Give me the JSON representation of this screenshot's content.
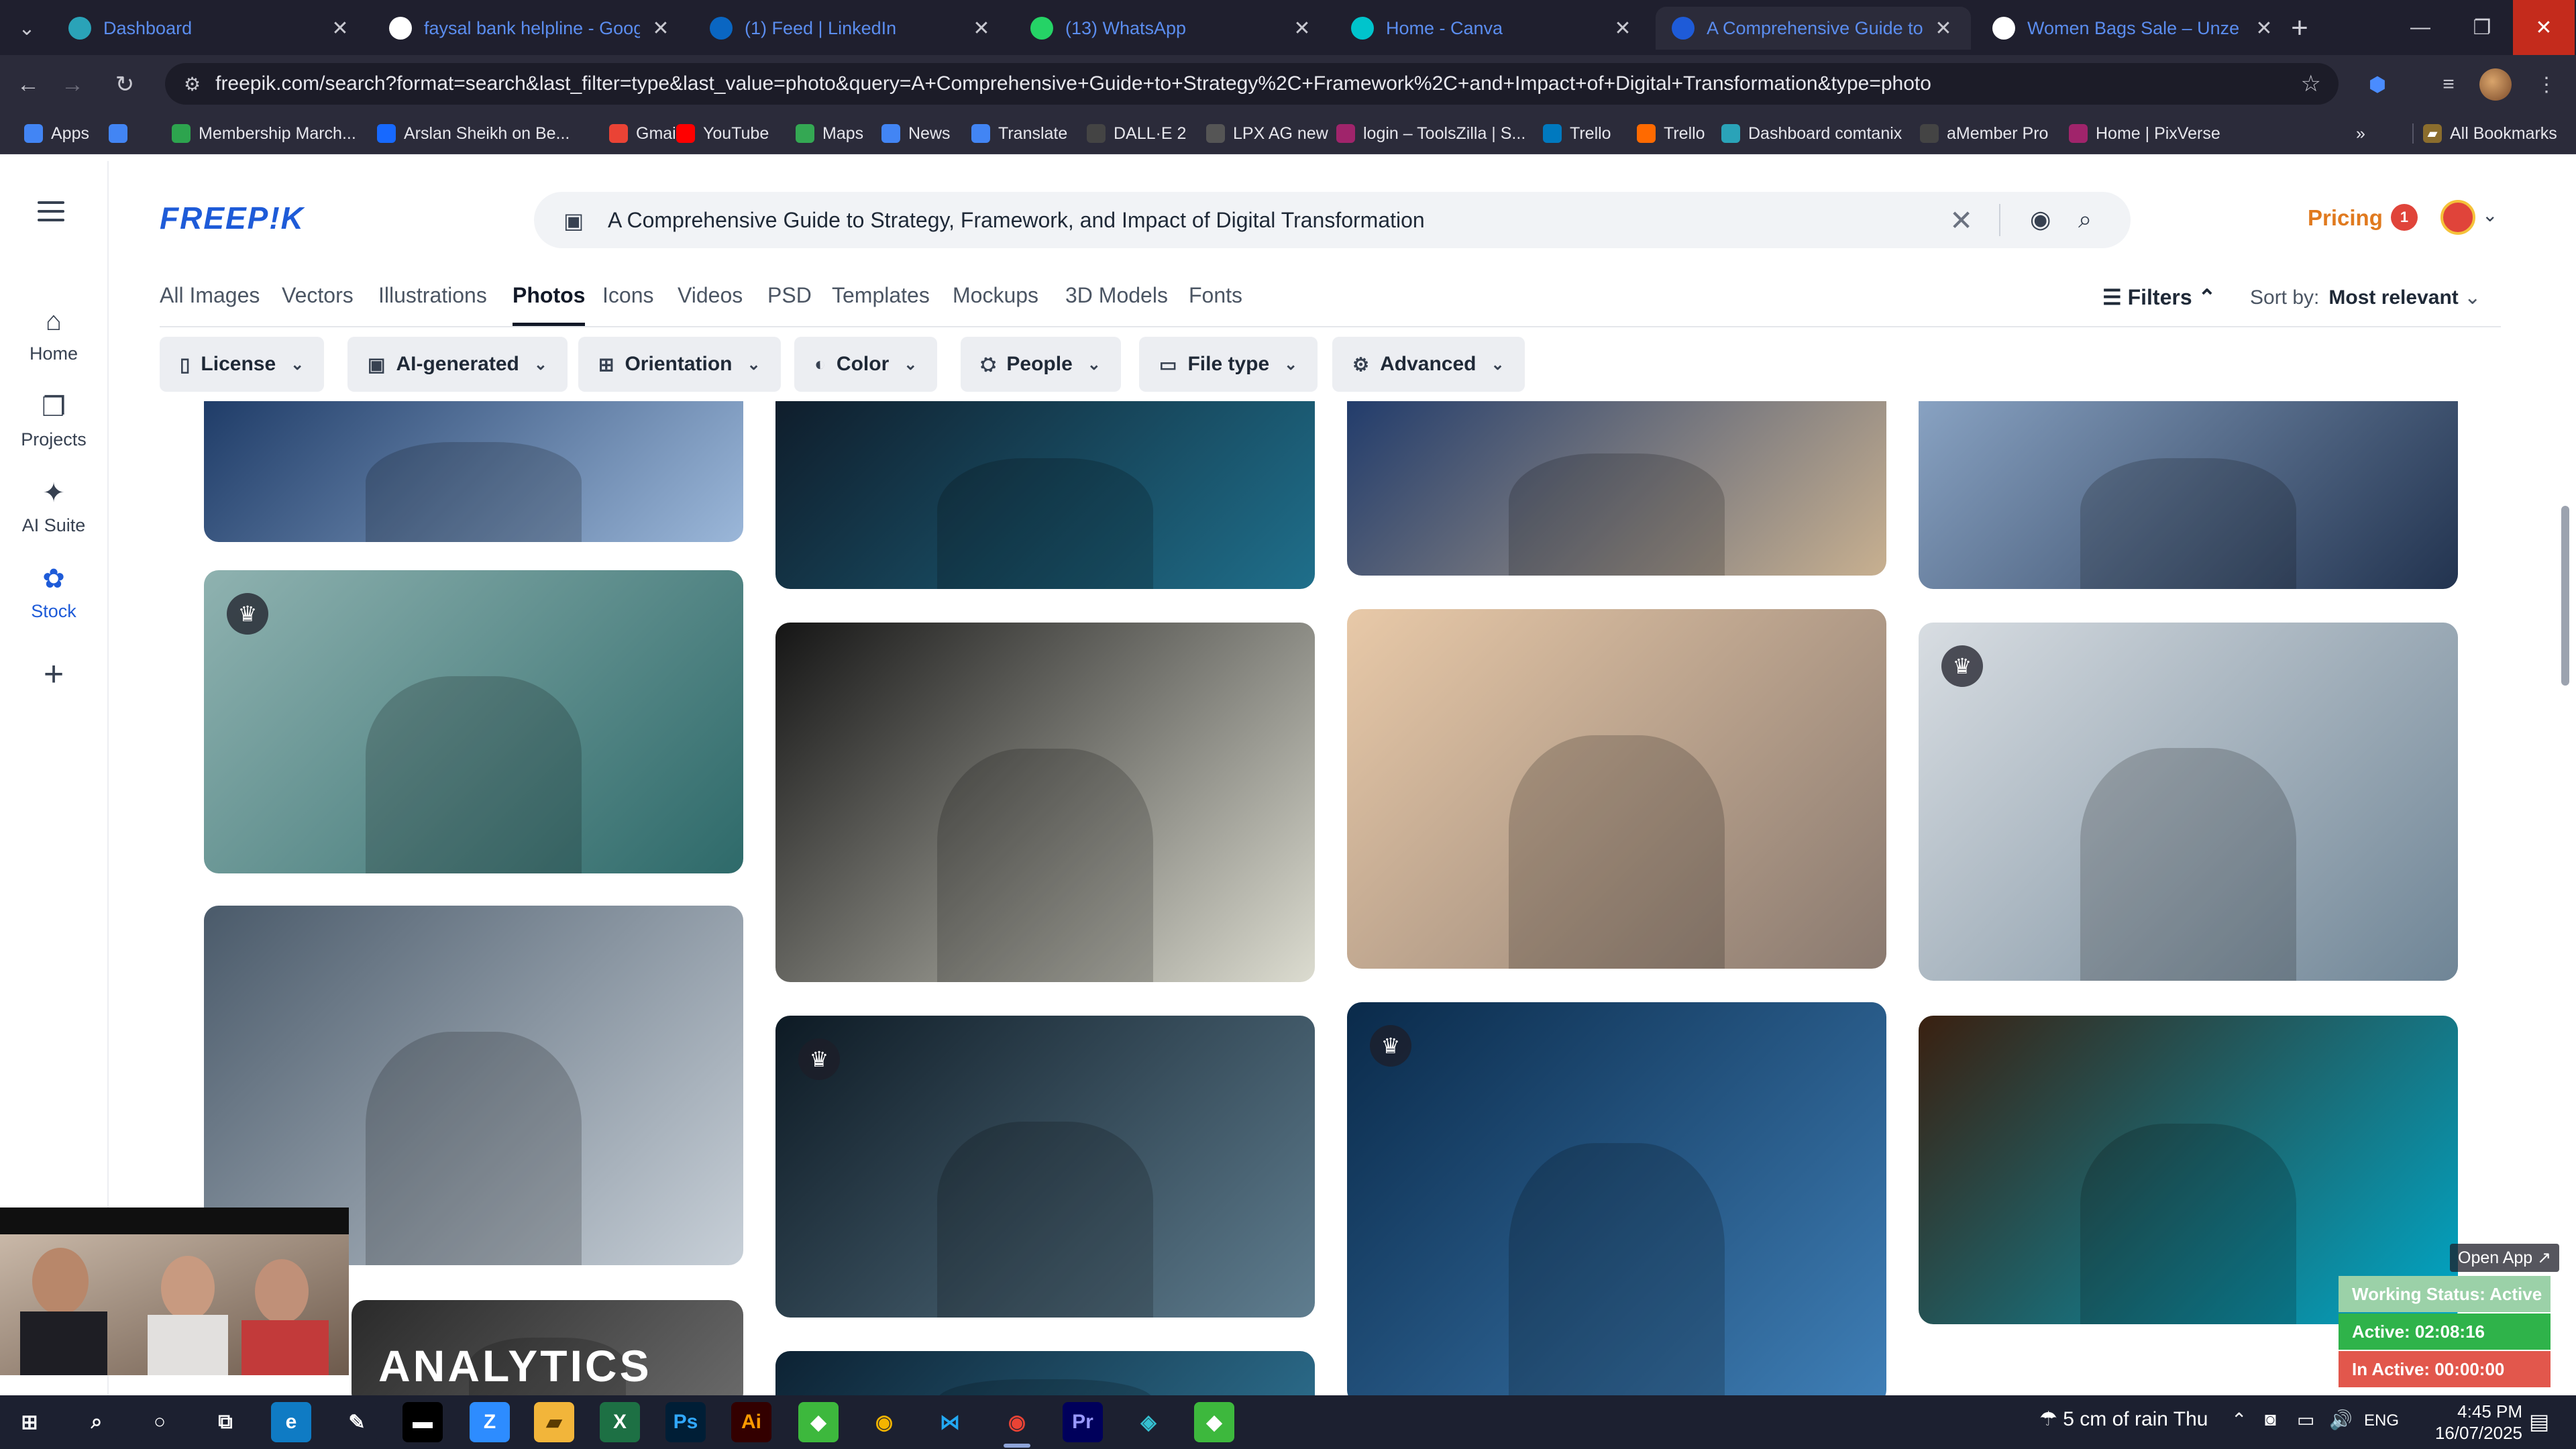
{
  "browser": {
    "tabs": [
      {
        "title": "Dashboard",
        "icon": "dashboard-favicon",
        "icon_color": "#2aa3b8"
      },
      {
        "title": "faysal bank helpline - Google S",
        "icon": "google-favicon",
        "icon_color": "#ffffff"
      },
      {
        "title": "(1) Feed | LinkedIn",
        "icon": "linkedin-favicon",
        "icon_color": "#0a66c2"
      },
      {
        "title": "(13) WhatsApp",
        "icon": "whatsapp-favicon",
        "icon_color": "#25d366"
      },
      {
        "title": "Home - Canva",
        "icon": "canva-favicon",
        "icon_color": "#00c4cc"
      },
      {
        "title": "A Comprehensive Guide to Stra",
        "icon": "freepik-favicon",
        "icon_color": "#1e5bd8"
      },
      {
        "title": "Women Bags Sale – Unze Lond",
        "icon": "unze-favicon",
        "icon_color": "#ffffff"
      }
    ],
    "url": "freepik.com/search?format=search&last_filter=type&last_value=photo&query=A+Comprehensive+Guide+to+Strategy%2C+Framework%2C+and+Impact+of+Digital+Transformation&type=photo",
    "bookmarks": [
      {
        "label": "Apps",
        "icon_color": "#4285f4"
      },
      {
        "label": "",
        "icon_color": "#4285f4"
      },
      {
        "label": "Membership March...",
        "icon_color": "#2da44e"
      },
      {
        "label": "Arslan Sheikh on Be...",
        "icon_color": "#1769ff"
      },
      {
        "label": "Gmail",
        "icon_color": "#ea4335"
      },
      {
        "label": "YouTube",
        "icon_color": "#ff0000"
      },
      {
        "label": "Maps",
        "icon_color": "#34a853"
      },
      {
        "label": "News",
        "icon_color": "#4285f4"
      },
      {
        "label": "Translate",
        "icon_color": "#4285f4"
      },
      {
        "label": "DALL·E 2",
        "icon_color": "#444444"
      },
      {
        "label": "LPX AG new",
        "icon_color": "#555555"
      },
      {
        "label": "login – ToolsZilla | S...",
        "icon_color": "#a0246b"
      },
      {
        "label": "Trello",
        "icon_color": "#0079bf"
      },
      {
        "label": "Trello",
        "icon_color": "#ff6a00"
      },
      {
        "label": "Dashboard comtanix",
        "icon_color": "#2aa3b8"
      },
      {
        "label": "aMember Pro",
        "icon_color": "#444444"
      },
      {
        "label": "Home | PixVerse",
        "icon_color": "#a0246b"
      }
    ],
    "all_bookmarks": "All Bookmarks",
    "more_bookmarks": "»"
  },
  "freepik": {
    "logo": "FREEP!K",
    "search_query": "A Comprehensive Guide to Strategy, Framework, and Impact of Digital Transformation",
    "pricing": "Pricing",
    "notification_count": "1",
    "sidenav": [
      {
        "label": "Home",
        "icon": "home-icon",
        "glyph": "⌂"
      },
      {
        "label": "Projects",
        "icon": "projects-icon",
        "glyph": "❐"
      },
      {
        "label": "AI Suite",
        "icon": "ai-suite-icon",
        "glyph": "✦"
      },
      {
        "label": "Stock",
        "icon": "stock-icon",
        "glyph": "✿"
      }
    ],
    "sidenav_add": "+",
    "type_tabs": [
      "All Images",
      "Vectors",
      "Illustrations",
      "Photos",
      "Icons",
      "Videos",
      "PSD",
      "Templates",
      "Mockups",
      "3D Models",
      "Fonts"
    ],
    "active_type_tab": "Photos",
    "filters_label": "Filters",
    "sort_label": "Sort by:",
    "sort_value": "Most relevant",
    "filter_chips": [
      {
        "label": "License",
        "icon": "license-icon",
        "glyph": "▯"
      },
      {
        "label": "AI-generated",
        "icon": "ai-generated-icon",
        "glyph": "▣"
      },
      {
        "label": "Orientation",
        "icon": "orientation-icon",
        "glyph": "⊞"
      },
      {
        "label": "Color",
        "icon": "color-palette-icon",
        "glyph": "◐"
      },
      {
        "label": "People",
        "icon": "people-icon",
        "glyph": "⛭"
      },
      {
        "label": "File type",
        "icon": "file-type-icon",
        "glyph": "▭"
      },
      {
        "label": "Advanced",
        "icon": "advanced-settings-icon",
        "glyph": "⚙"
      }
    ],
    "photos": [
      {
        "subject": "business-handshake-office",
        "premium": false,
        "colors": [
          "#1d3a66",
          "#9bb7d9"
        ]
      },
      {
        "subject": "tablet-touch-digital",
        "premium": false,
        "colors": [
          "#0f1c2a",
          "#1f6f8b"
        ]
      },
      {
        "subject": "wooden-blocks-icons",
        "premium": false,
        "colors": [
          "#1f3a6b",
          "#c8b090"
        ]
      },
      {
        "subject": "man-at-monitor",
        "premium": false,
        "colors": [
          "#8aa4c4",
          "#22334f"
        ]
      },
      {
        "subject": "team-hologram-table",
        "premium": true,
        "colors": [
          "#8fb2b0",
          "#2e6a6a"
        ]
      },
      {
        "subject": "silhouettes-sticky-notes",
        "premium": false,
        "colors": [
          "#151515",
          "#dcdcd0"
        ]
      },
      {
        "subject": "team-aerial-network",
        "premium": false,
        "colors": [
          "#e8c9a8",
          "#8a7a70"
        ]
      },
      {
        "subject": "team-holographic-city",
        "premium": true,
        "colors": [
          "#d8dde2",
          "#6f8596"
        ]
      },
      {
        "subject": "man-dashboard-desk",
        "premium": false,
        "colors": [
          "#4a5a6a",
          "#c8d0d8"
        ]
      },
      {
        "subject": "overhead-virtual-screen",
        "premium": true,
        "colors": [
          "#0d1a24",
          "#5f7d8f"
        ]
      },
      {
        "subject": "idea-icons-businessmen",
        "premium": true,
        "colors": [
          "#0a2a4a",
          "#3f7fb7"
        ]
      },
      {
        "subject": "boardroom-holograms",
        "premium": false,
        "colors": [
          "#3a2010",
          "#00a8c8"
        ]
      },
      {
        "subject": "analytics-chalkboard",
        "premium": false,
        "colors": [
          "#2a2a2a",
          "#6a6a6a"
        ],
        "text": "ANALYTICS"
      },
      {
        "subject": "digital-lines",
        "premium": false,
        "colors": [
          "#0d2233",
          "#2c6d8c"
        ]
      }
    ],
    "open_app": "Open App ↗",
    "work_status": [
      {
        "label": "Working Status: Active",
        "bg": "#9bd1a8",
        "fg": "#ffffff"
      },
      {
        "label": "Active: 02:08:16",
        "bg": "#2fb34a",
        "fg": "#ffffff"
      },
      {
        "label": "In Active: 00:00:00",
        "bg": "#e2574c",
        "fg": "#ffffff"
      }
    ]
  },
  "taskbar": {
    "apps": [
      {
        "icon": "windows-start-icon",
        "glyph": "⊞",
        "bg": "#1c2030",
        "fg": "#ffffff"
      },
      {
        "icon": "search-icon",
        "glyph": "⌕",
        "bg": "#1c2030",
        "fg": "#ffffff"
      },
      {
        "icon": "cortana-icon",
        "glyph": "○",
        "bg": "#1c2030",
        "fg": "#ffffff"
      },
      {
        "icon": "task-view-icon",
        "glyph": "⧉",
        "bg": "#1c2030",
        "fg": "#ffffff"
      },
      {
        "icon": "edge-icon",
        "glyph": "e",
        "bg": "#0f7bc4",
        "fg": "#ffffff"
      },
      {
        "icon": "pen-icon",
        "glyph": "✎",
        "bg": "#1c2030",
        "fg": "#ffffff"
      },
      {
        "icon": "terminal-icon",
        "glyph": "▬",
        "bg": "#000000",
        "fg": "#ffffff"
      },
      {
        "icon": "zoom-icon",
        "glyph": "Z",
        "bg": "#2d8cff",
        "fg": "#ffffff"
      },
      {
        "icon": "file-explorer-icon",
        "glyph": "▰",
        "bg": "#f2b53a",
        "fg": "#5a3a00"
      },
      {
        "icon": "excel-icon",
        "glyph": "X",
        "bg": "#1d7044",
        "fg": "#ffffff"
      },
      {
        "icon": "photoshop-icon",
        "glyph": "Ps",
        "bg": "#001e36",
        "fg": "#31a8ff"
      },
      {
        "icon": "illustrator-icon",
        "glyph": "Ai",
        "bg": "#330000",
        "fg": "#ff9a00"
      },
      {
        "icon": "green-app-icon",
        "glyph": "◆",
        "bg": "#3db83d",
        "fg": "#ffffff"
      },
      {
        "icon": "chrome-icon",
        "glyph": "◉",
        "bg": "#1c2030",
        "fg": "#f4b400"
      },
      {
        "icon": "vscode-icon",
        "glyph": "⋈",
        "bg": "#1c2030",
        "fg": "#23a9f2"
      },
      {
        "icon": "chrome-profile-icon",
        "glyph": "◉",
        "bg": "#1c2030",
        "fg": "#ea4335"
      },
      {
        "icon": "premiere-icon",
        "glyph": "Pr",
        "bg": "#00005b",
        "fg": "#9999ff"
      },
      {
        "icon": "teal-app-icon",
        "glyph": "◈",
        "bg": "#1c2030",
        "fg": "#35c0d0"
      },
      {
        "icon": "green-app-2-icon",
        "glyph": "◆",
        "bg": "#3db83d",
        "fg": "#ffffff"
      }
    ],
    "weather": "5 cm of rain Thu",
    "language": "ENG",
    "time": "4:45 PM",
    "date": "16/07/2025"
  }
}
